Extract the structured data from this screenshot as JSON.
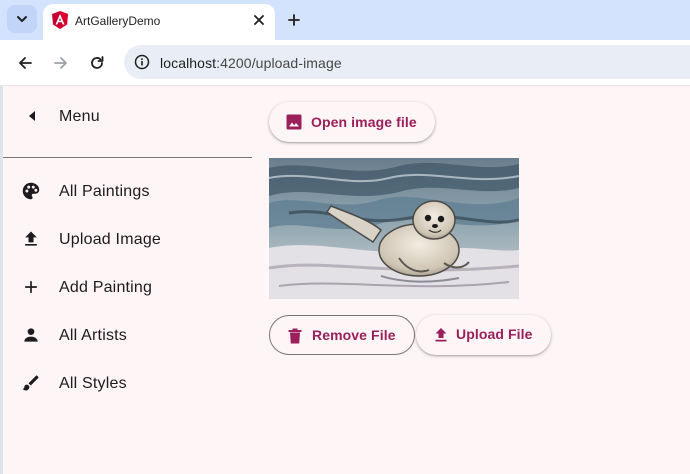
{
  "browser": {
    "tab_title": "ArtGalleryDemo",
    "url_host": "localhost",
    "url_path": ":4200/upload-image"
  },
  "sidenav": {
    "menu_label": "Menu",
    "items": [
      {
        "label": "All Paintings",
        "icon": "palette-icon"
      },
      {
        "label": "Upload Image",
        "icon": "upload-icon"
      },
      {
        "label": "Add Painting",
        "icon": "plus-icon"
      },
      {
        "label": "All Artists",
        "icon": "person-icon"
      },
      {
        "label": "All Styles",
        "icon": "brush-icon"
      }
    ]
  },
  "upload": {
    "open_label": "Open image file",
    "remove_label": "Remove File",
    "upload_label": "Upload File"
  },
  "colors": {
    "accent": "#9b1f5a",
    "background": "#fdf5f6",
    "browser_tabbar": "#d3e3fd"
  }
}
